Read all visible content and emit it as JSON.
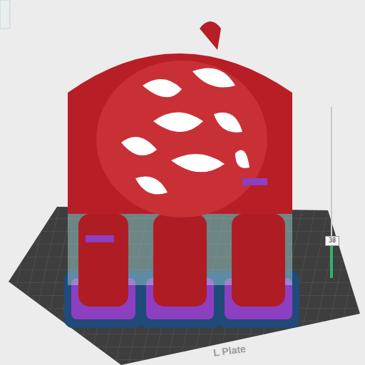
{
  "plate": {
    "label": "L Plate"
  },
  "layer_slider": {
    "level": 0.22,
    "reading": "38"
  }
}
